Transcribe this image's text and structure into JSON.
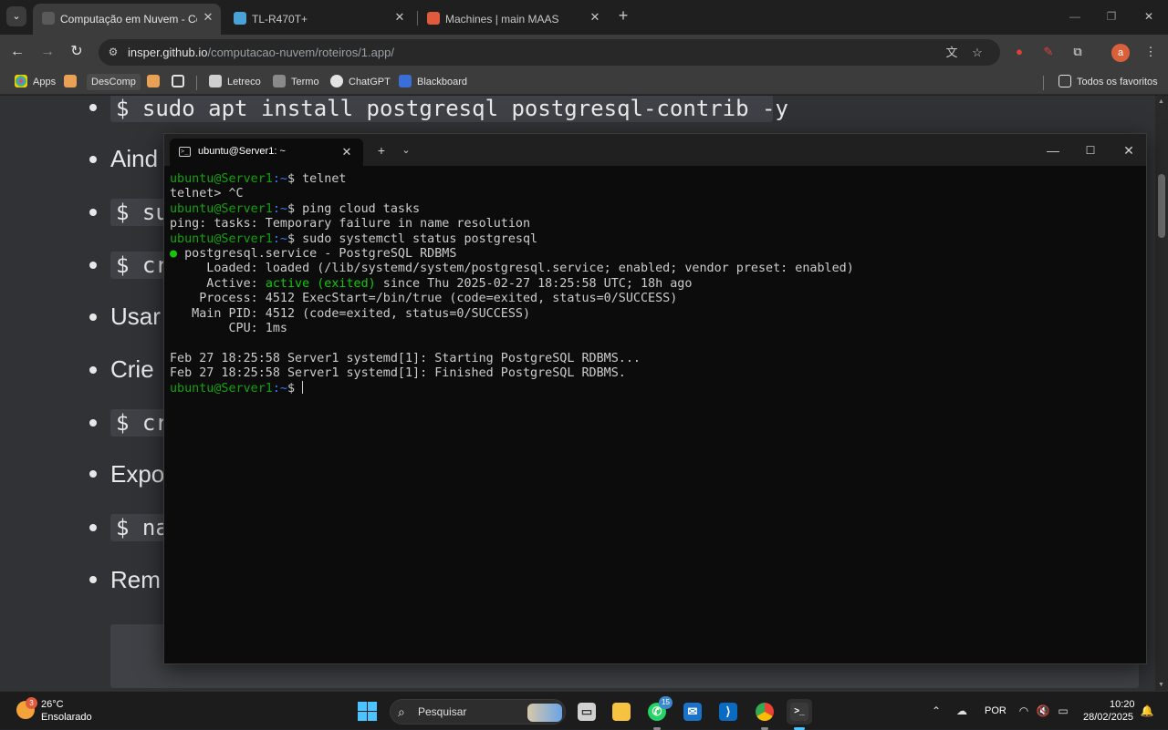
{
  "browser": {
    "tabs": [
      {
        "title": "Computação em Nuvem - Com",
        "active": true
      },
      {
        "title": "TL-R470T+",
        "active": false
      },
      {
        "title": "Machines | main MAAS",
        "active": false
      }
    ],
    "url_host": "insper.github.io",
    "url_path": "/computacao-nuvem/roteiros/1.app/",
    "profile_initial": "a",
    "bookmarks": [
      {
        "label": "Apps"
      },
      {
        "label": "DesComp"
      },
      {
        "label": ""
      },
      {
        "label": ""
      },
      {
        "label": "Letreco"
      },
      {
        "label": "Termo"
      },
      {
        "label": "ChatGPT"
      },
      {
        "label": "Blackboard"
      }
    ],
    "all_bookmarks": "Todos os favoritos"
  },
  "page": {
    "items": [
      {
        "kind": "code",
        "text": "$ sudo apt install postgresql postgresql-contrib -y"
      },
      {
        "kind": "text",
        "text": "Aind"
      },
      {
        "kind": "code",
        "text": "$ su"
      },
      {
        "kind": "code",
        "text": "$ cr"
      },
      {
        "kind": "text",
        "text": "Usar"
      },
      {
        "kind": "text",
        "text": "Crie"
      },
      {
        "kind": "code",
        "text": "$ cr"
      },
      {
        "kind": "text",
        "text": "Expo"
      },
      {
        "kind": "code",
        "text": "$ na"
      },
      {
        "kind": "text",
        "text": "Rem"
      }
    ]
  },
  "terminal": {
    "tab_title": "ubuntu@Server1: ~",
    "prompt_user": "ubuntu@Server1",
    "prompt_path": ":~",
    "prompt_sign": "$ ",
    "lines": [
      {
        "type": "prompt",
        "cmd": "telnet"
      },
      {
        "type": "out",
        "text": "telnet> ^C"
      },
      {
        "type": "prompt",
        "cmd": "ping cloud tasks"
      },
      {
        "type": "out",
        "text": "ping: tasks: Temporary failure in name resolution"
      },
      {
        "type": "prompt",
        "cmd": "sudo systemctl status postgresql"
      },
      {
        "type": "dot",
        "text": "postgresql.service - PostgreSQL RDBMS"
      },
      {
        "type": "out",
        "text": "     Loaded: loaded (/lib/systemd/system/postgresql.service; enabled; vendor preset: enabled)"
      },
      {
        "type": "active",
        "pre": "     Active: ",
        "hl": "active (exited)",
        "post": " since Thu 2025-02-27 18:25:58 UTC; 18h ago"
      },
      {
        "type": "out",
        "text": "    Process: 4512 ExecStart=/bin/true (code=exited, status=0/SUCCESS)"
      },
      {
        "type": "out",
        "text": "   Main PID: 4512 (code=exited, status=0/SUCCESS)"
      },
      {
        "type": "out",
        "text": "        CPU: 1ms"
      },
      {
        "type": "out",
        "text": ""
      },
      {
        "type": "out",
        "text": "Feb 27 18:25:58 Server1 systemd[1]: Starting PostgreSQL RDBMS..."
      },
      {
        "type": "out",
        "text": "Feb 27 18:25:58 Server1 systemd[1]: Finished PostgreSQL RDBMS."
      },
      {
        "type": "prompt",
        "cmd": "",
        "cursor": true
      }
    ]
  },
  "taskbar": {
    "weather_badge": "3",
    "weather_temp": "26°C",
    "weather_desc": "Ensolarado",
    "search_placeholder": "Pesquisar",
    "whatsapp_badge": "15",
    "language": "POR",
    "time": "10:20",
    "date": "28/02/2025"
  },
  "colors": {
    "terminal_bg": "#0c0c0c",
    "prompt_green": "#13a10e",
    "prompt_blue": "#3b78ff",
    "page_bg": "#303236",
    "code_bg": "#3f4146"
  }
}
